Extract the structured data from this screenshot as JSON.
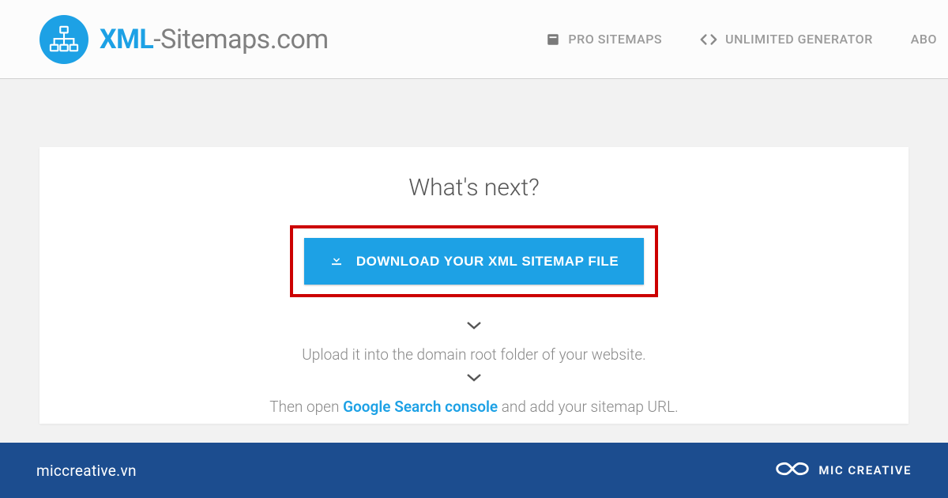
{
  "header": {
    "logo": {
      "xml": "XML",
      "rest": "-Sitemaps.com"
    },
    "nav": {
      "pro": "PRO SITEMAPS",
      "unlimited": "UNLIMITED GENERATOR",
      "about": "ABO"
    }
  },
  "main": {
    "heading": "What's next?",
    "download_button": "DOWNLOAD YOUR XML SITEMAP FILE",
    "step1": "Upload it into the domain root folder of your website.",
    "step2_prefix": "Then open ",
    "step2_link": "Google Search console",
    "step2_suffix": " and add your sitemap URL."
  },
  "footer": {
    "domain": "miccreative.vn",
    "brand": "MIC CREATIVE"
  }
}
